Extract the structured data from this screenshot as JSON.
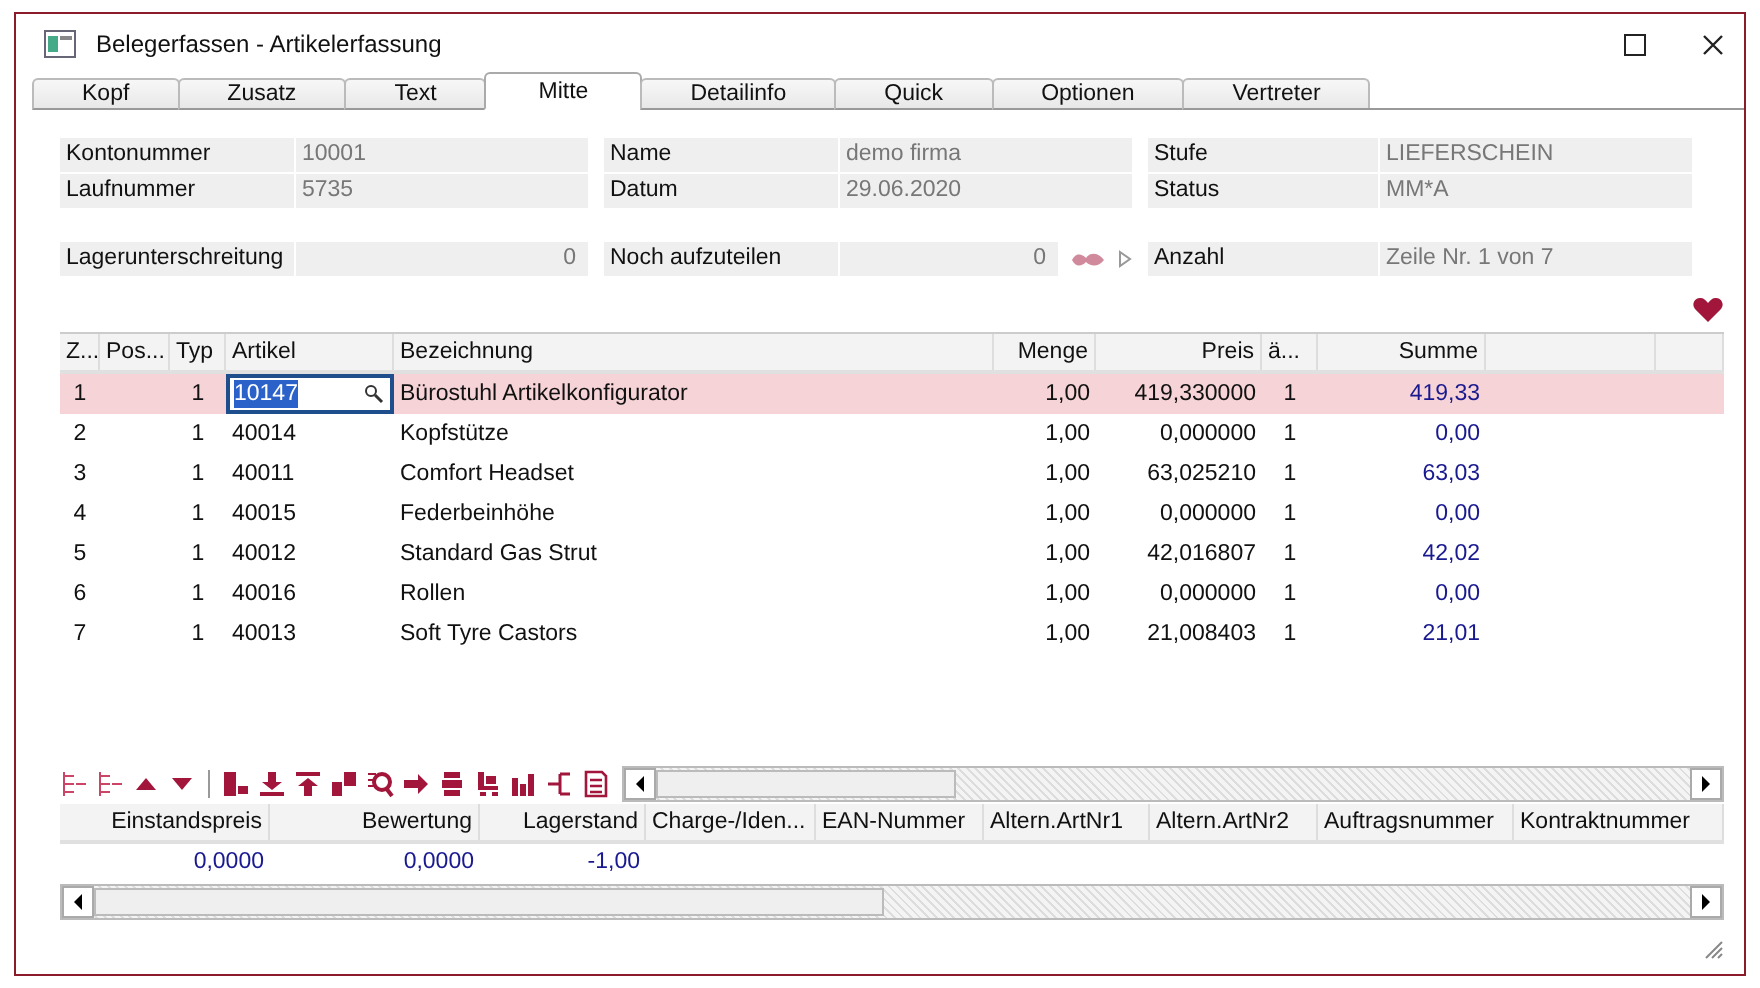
{
  "window": {
    "title": "Belegerfassen - Artikelerfassung"
  },
  "tabs": [
    {
      "label": "Kopf",
      "selected": false
    },
    {
      "label": "Zusatz",
      "selected": false
    },
    {
      "label": "Text",
      "selected": false
    },
    {
      "label": "Mitte",
      "selected": true
    },
    {
      "label": "Detailinfo",
      "selected": false
    },
    {
      "label": "Quick",
      "selected": false
    },
    {
      "label": "Optionen",
      "selected": false
    },
    {
      "label": "Vertreter",
      "selected": false
    }
  ],
  "fields": [
    {
      "label": "Kontonummer",
      "value": "10001"
    },
    {
      "label": "Name",
      "value": "demo firma"
    },
    {
      "label": "Stufe",
      "value": "LIEFERSCHEIN"
    },
    {
      "label": "Laufnummer",
      "value": "5735"
    },
    {
      "label": "Datum",
      "value": "29.06.2020"
    },
    {
      "label": "Status",
      "value": "MM*A"
    }
  ],
  "counters": [
    {
      "label": "Lagerunterschreitung",
      "value": "0"
    },
    {
      "label": "Noch aufzuteilen",
      "value": "0"
    },
    {
      "label": "Anzahl",
      "value": "Zeile Nr. 1 von 7"
    }
  ],
  "grid": {
    "columns": [
      "Z...",
      "Pos...",
      "Typ",
      "Artikel",
      "Bezeichnung",
      "Menge",
      "Preis",
      "ä...",
      "Summe"
    ],
    "rows": [
      {
        "selected": true,
        "cells": [
          "1",
          "",
          "1",
          "10147",
          "Bürostuhl Artikelkonfigurator",
          "1,00",
          "419,330000",
          "1",
          "419,33"
        ]
      },
      {
        "selected": false,
        "cells": [
          "2",
          "",
          "1",
          "40014",
          "Kopfstütze",
          "1,00",
          "0,000000",
          "1",
          "0,00"
        ]
      },
      {
        "selected": false,
        "cells": [
          "3",
          "",
          "1",
          "40011",
          "Comfort Headset",
          "1,00",
          "63,025210",
          "1",
          "63,03"
        ]
      },
      {
        "selected": false,
        "cells": [
          "4",
          "",
          "1",
          "40015",
          "Federbeinhöhe",
          "1,00",
          "0,000000",
          "1",
          "0,00"
        ]
      },
      {
        "selected": false,
        "cells": [
          "5",
          "",
          "1",
          "40012",
          "Standard Gas Strut",
          "1,00",
          "42,016807",
          "1",
          "42,02"
        ]
      },
      {
        "selected": false,
        "cells": [
          "6",
          "",
          "1",
          "40016",
          "Rollen",
          "1,00",
          "0,000000",
          "1",
          "0,00"
        ]
      },
      {
        "selected": false,
        "cells": [
          "7",
          "",
          "1",
          "40013",
          "Soft Tyre Castors",
          "1,00",
          "21,008403",
          "1",
          "21,01"
        ]
      }
    ]
  },
  "detail": {
    "columns": [
      "Einstandspreis",
      "Bewertung",
      "Lagerstand",
      "Charge-/Iden...",
      "EAN-Nummer",
      "Altern.ArtNr1",
      "Altern.ArtNr2",
      "Auftragsnummer",
      "Kontraktnummer"
    ],
    "values": [
      "0,0000",
      "0,0000",
      "-1,00"
    ]
  }
}
